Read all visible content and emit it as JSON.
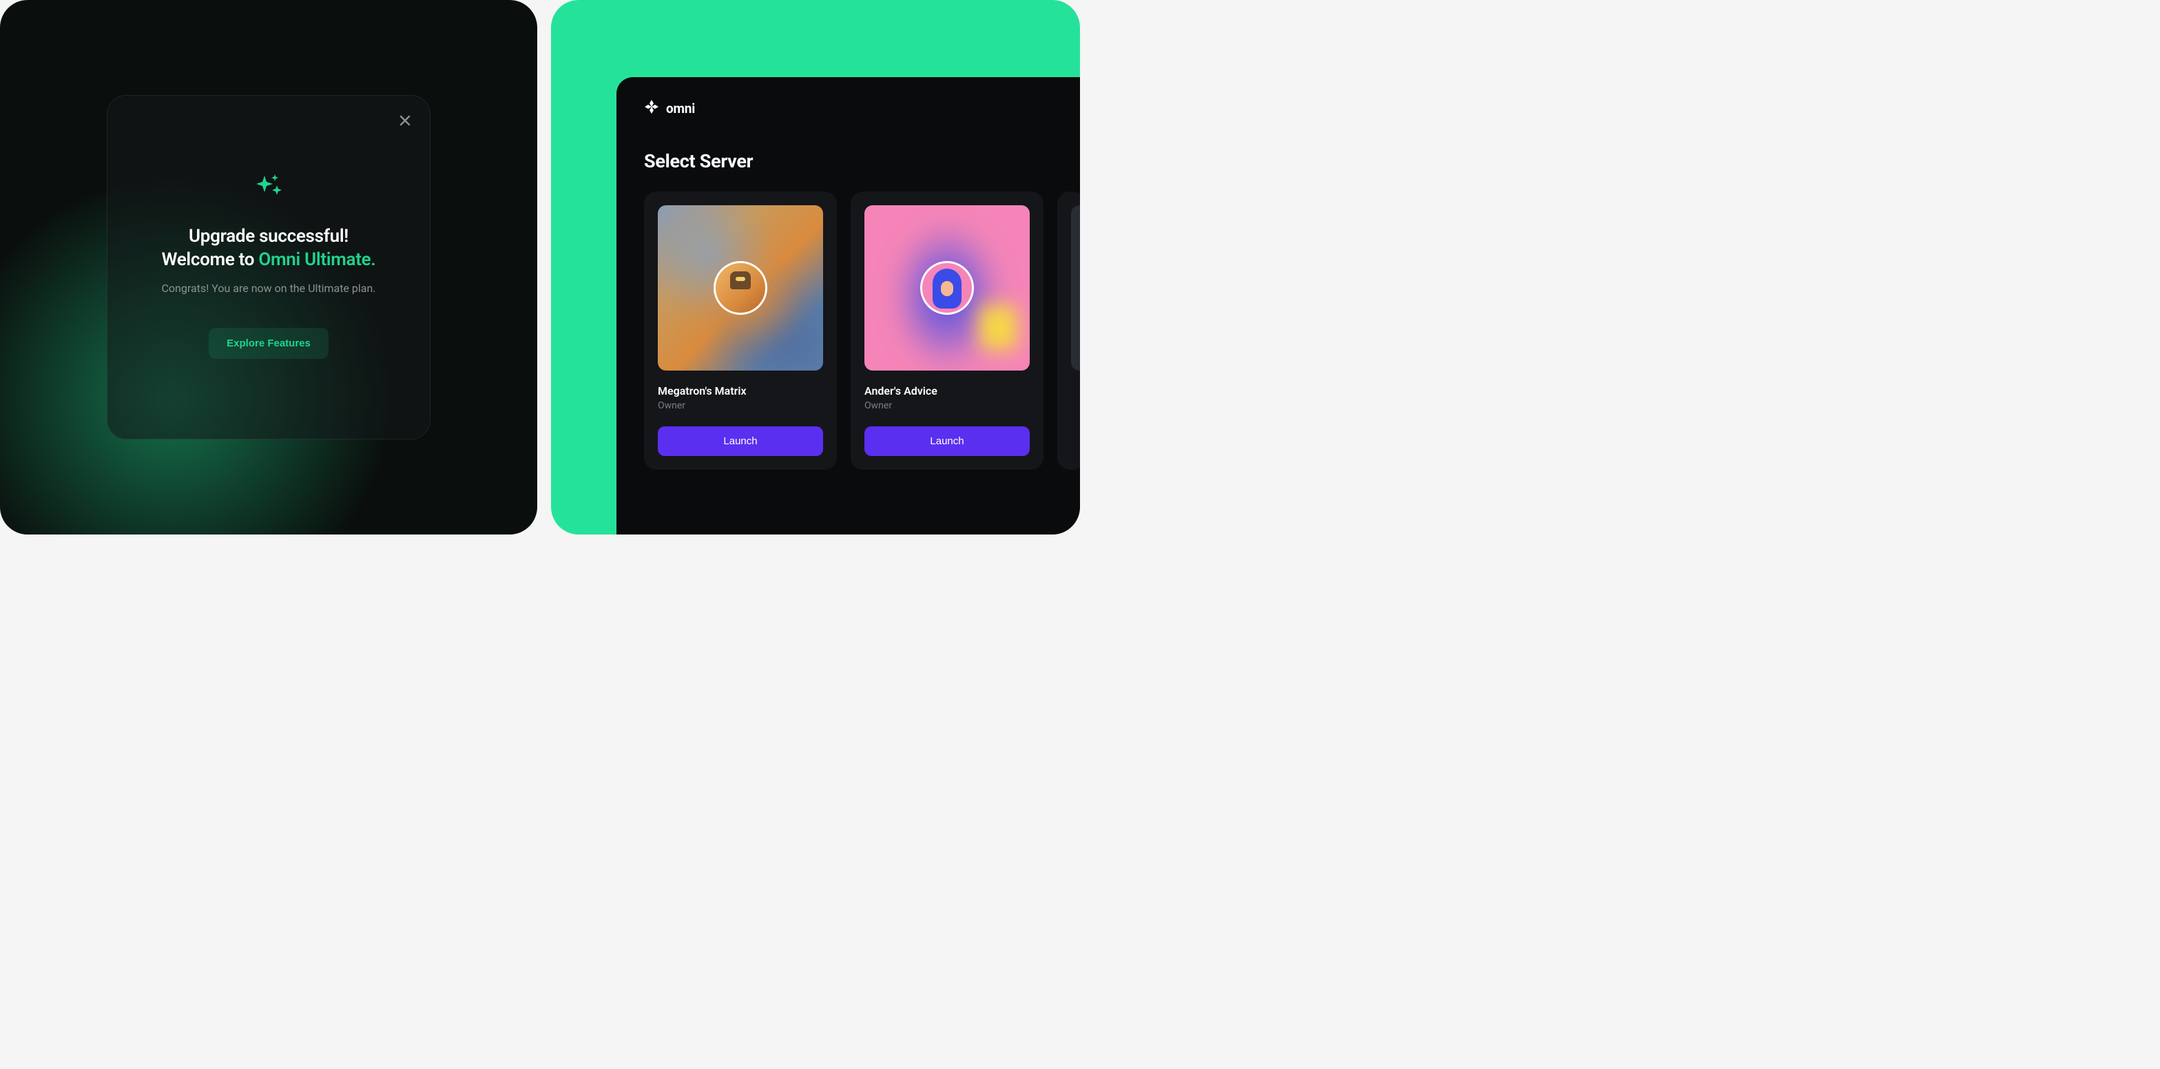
{
  "modal": {
    "title_line1": "Upgrade successful!",
    "title_line2_prefix": "Welcome to ",
    "title_line2_highlight": "Omni Ultimate.",
    "subtitle": "Congrats! You are now on the Ultimate plan.",
    "cta_label": "Explore Features"
  },
  "app": {
    "brand": "omni",
    "section_title": "Select Server",
    "servers": [
      {
        "name": "Megatron's Matrix",
        "role": "Owner",
        "action_label": "Launch"
      },
      {
        "name": "Ander's Advice",
        "role": "Owner",
        "action_label": "Launch"
      }
    ]
  }
}
